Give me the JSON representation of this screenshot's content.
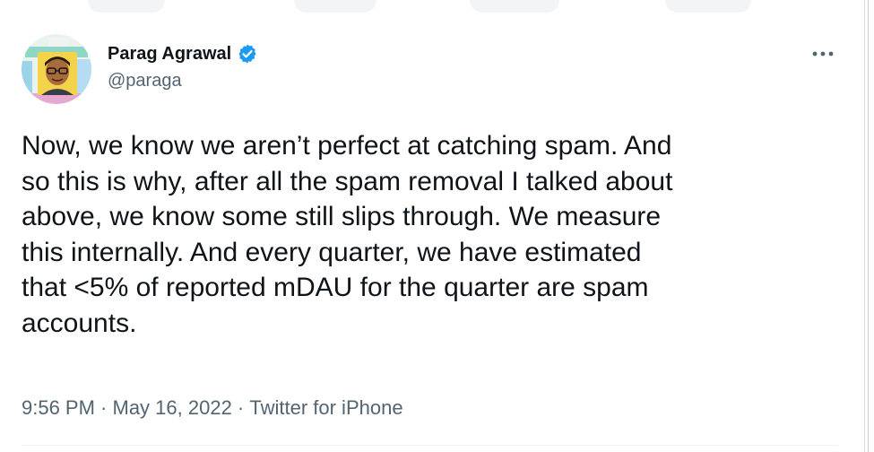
{
  "author": {
    "name": "Parag Agrawal",
    "handle": "@paraga",
    "verified": true
  },
  "tweet": {
    "text": "Now, we know we aren’t perfect at catching spam. And\nso this is why, after all the spam removal I talked about\nabove, we know some still slips through. We measure\nthis internally. And every quarter, we have estimated\nthat <5% of reported mDAU for the quarter are spam\naccounts."
  },
  "meta": {
    "time": "9:56 PM",
    "separator": " · ",
    "date": "May 16, 2022",
    "source": "Twitter for iPhone"
  },
  "colors": {
    "primary_text": "#0f1419",
    "secondary_text": "#536471",
    "verified_blue": "#1d9bf0"
  },
  "icons": {
    "verified": "verified-badge-icon",
    "more": "more-options-icon"
  }
}
